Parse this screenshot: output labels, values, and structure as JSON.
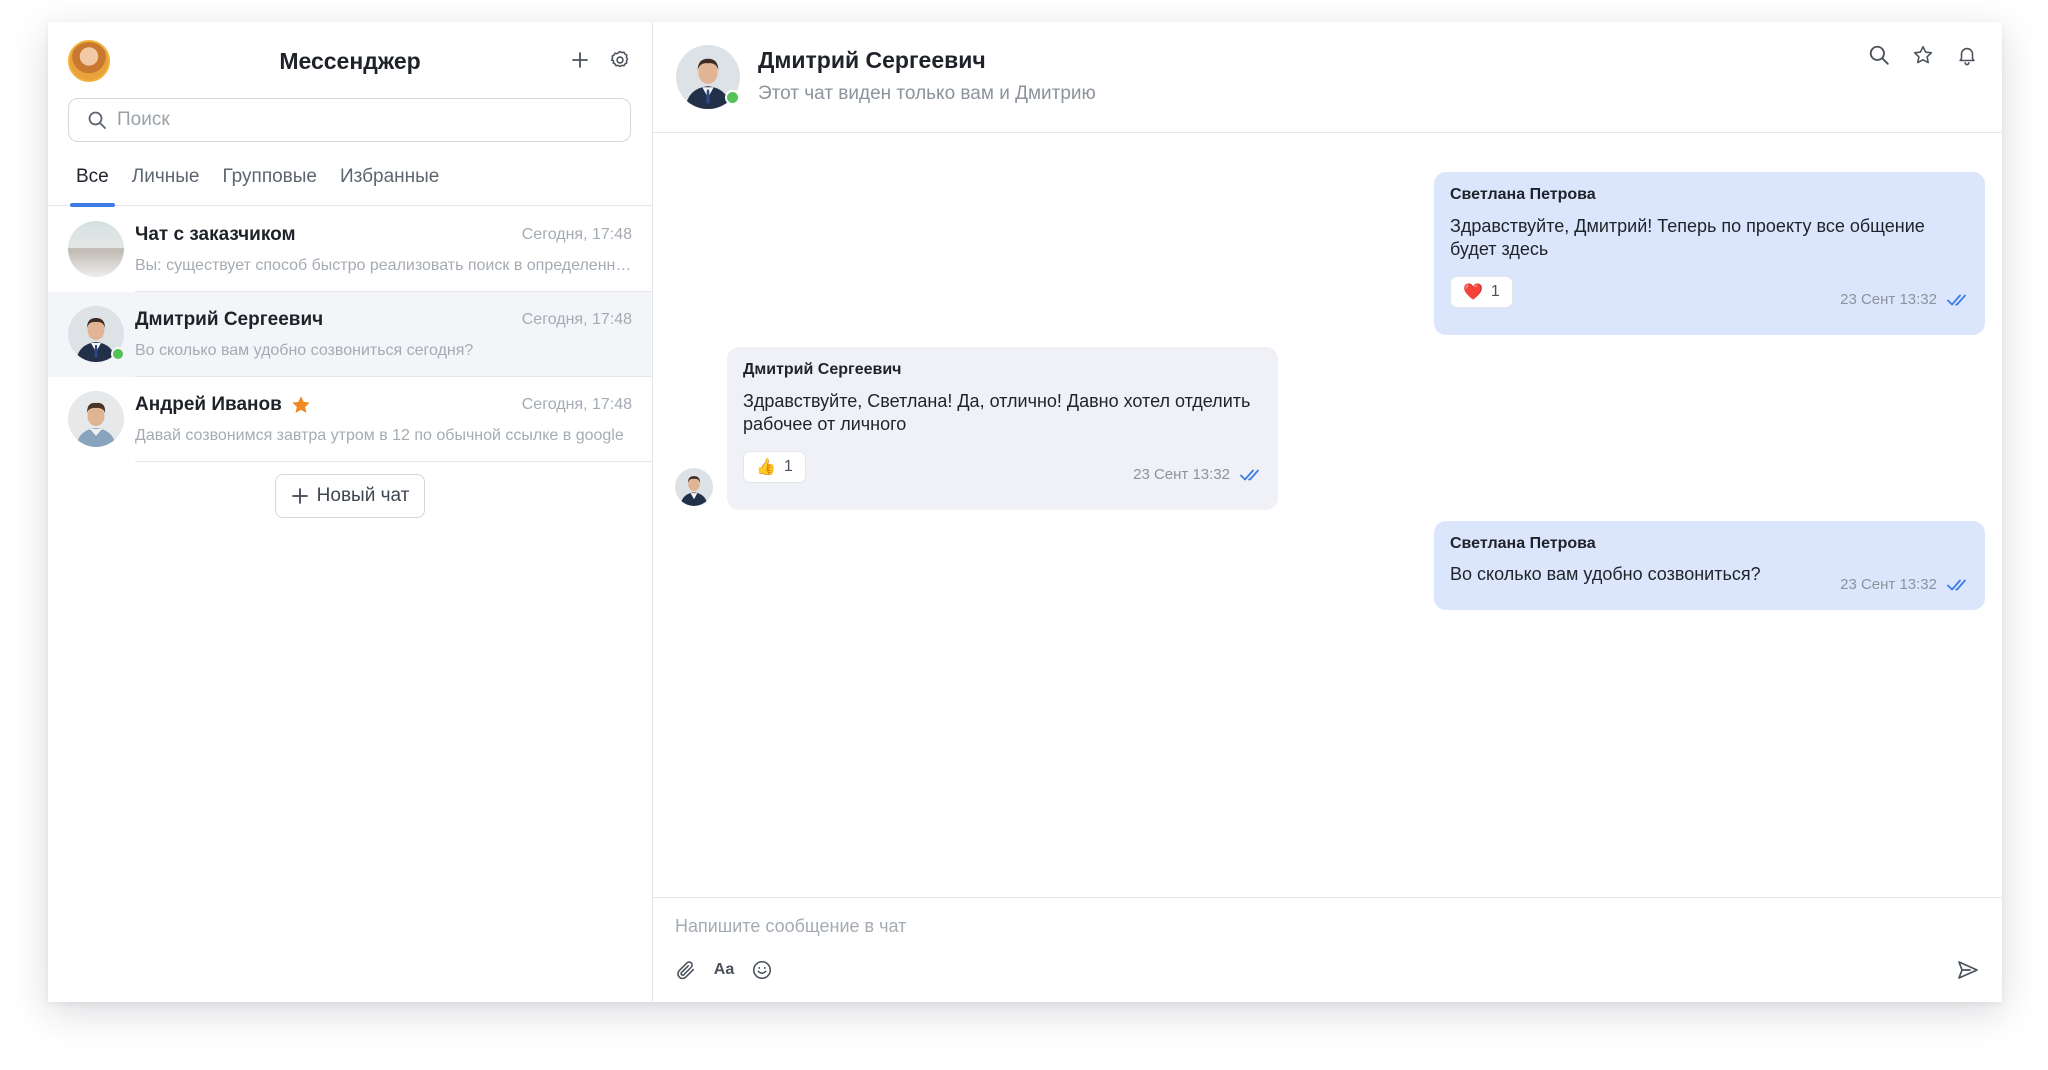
{
  "app": {
    "title": "Мессенджер"
  },
  "search": {
    "placeholder": "Поиск"
  },
  "tabs": [
    {
      "label": "Все",
      "active": true
    },
    {
      "label": "Личные",
      "active": false
    },
    {
      "label": "Групповые",
      "active": false
    },
    {
      "label": "Избранные",
      "active": false
    }
  ],
  "chats": [
    {
      "name": "Чат с заказчиком",
      "time": "Сегодня, 17:48",
      "preview": "Вы: существует способ быстро реализовать поиск в определенном"
    },
    {
      "name": "Дмитрий Сергеевич",
      "time": "Сегодня, 17:48",
      "preview": "Во сколько вам удобно созвониться сегодня?",
      "online": true,
      "active": true
    },
    {
      "name": "Андрей Иванов",
      "time": "Сегодня, 17:48",
      "preview": "Давай созвонимся завтра утром в 12 по обычной ссылке в google",
      "starred": true
    }
  ],
  "new_chat_label": "Новый чат",
  "conversation": {
    "name": "Дмитрий Сергеевич",
    "subtitle": "Этот чат виден только вам и Дмитрию"
  },
  "messages": [
    {
      "author": "Светлана Петрова",
      "text": "Здравствуйте, Дмитрий! Теперь по проекту все общение будет здесь",
      "time": "23 Сент 13:32",
      "reaction_emoji": "❤️",
      "reaction_count": "1",
      "direction": "out"
    },
    {
      "author": "Дмитрий Сергеевич",
      "text": "Здравствуйте, Светлана! Да, отлично! Давно хотел отделить рабочее от личного",
      "time": "23 Сент 13:32",
      "reaction_emoji": "👍",
      "reaction_count": "1",
      "direction": "in"
    },
    {
      "author": "Светлана Петрова",
      "text": "Во сколько вам удобно созвониться?",
      "time": "23 Сент 13:32",
      "direction": "out"
    }
  ],
  "composer": {
    "placeholder": "Напишите сообщение в чат",
    "format_label": "Aa"
  },
  "icons": {
    "add": "plus-icon",
    "settings": "gear-icon",
    "search": "search-icon",
    "favorite": "star-icon",
    "notifications": "bell-icon",
    "attach": "paperclip-icon",
    "format": "text-format-icon",
    "emoji": "smile-icon",
    "send": "send-icon",
    "read": "double-check-icon"
  },
  "colors": {
    "accent": "#3d7be6",
    "outgoing_bubble": "#dbe6fc",
    "incoming_bubble": "#f0f1f6",
    "online": "#53c257",
    "star": "#f08a24",
    "read_check": "#3d7be6"
  }
}
